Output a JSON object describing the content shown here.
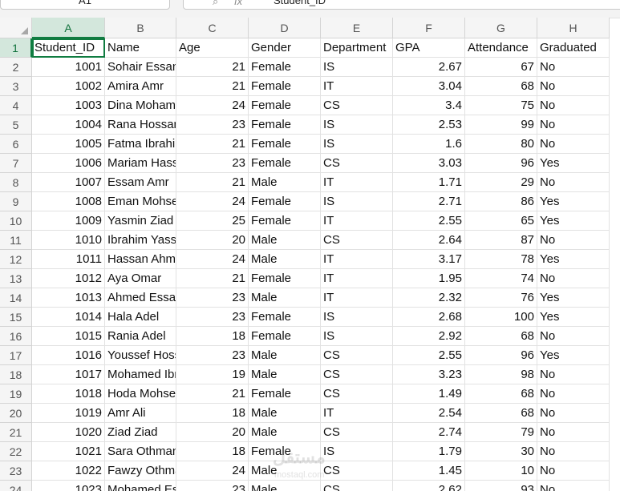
{
  "name_box": "A1",
  "formula_bar": {
    "icons": [
      "search-icon",
      "function-icon"
    ],
    "content": "Student_ID"
  },
  "columns": [
    "A",
    "B",
    "C",
    "D",
    "E",
    "F",
    "G",
    "H"
  ],
  "header_row": [
    "Student_ID",
    "Name",
    "Age",
    "Gender",
    "Department",
    "GPA",
    "Attendance",
    "Graduated"
  ],
  "rows": [
    {
      "n": "2",
      "cells": [
        "1001",
        "Sohair Essam",
        "21",
        "Female",
        "IS",
        "2.67",
        "67",
        "No"
      ]
    },
    {
      "n": "3",
      "cells": [
        "1002",
        "Amira Amr",
        "21",
        "Female",
        "IT",
        "3.04",
        "68",
        "No"
      ]
    },
    {
      "n": "4",
      "cells": [
        "1003",
        "Dina Mohamed",
        "24",
        "Female",
        "CS",
        "3.4",
        "75",
        "No"
      ]
    },
    {
      "n": "5",
      "cells": [
        "1004",
        "Rana Hossam",
        "23",
        "Female",
        "IS",
        "2.53",
        "99",
        "No"
      ]
    },
    {
      "n": "6",
      "cells": [
        "1005",
        "Fatma Ibrahim",
        "21",
        "Female",
        "IS",
        "1.6",
        "80",
        "No"
      ]
    },
    {
      "n": "7",
      "cells": [
        "1006",
        "Mariam Hassan",
        "23",
        "Female",
        "CS",
        "3.03",
        "96",
        "Yes"
      ]
    },
    {
      "n": "8",
      "cells": [
        "1007",
        "Essam Amr",
        "21",
        "Male",
        "IT",
        "1.71",
        "29",
        "No"
      ]
    },
    {
      "n": "9",
      "cells": [
        "1008",
        "Eman Mohsen",
        "24",
        "Female",
        "IS",
        "2.71",
        "86",
        "Yes"
      ]
    },
    {
      "n": "10",
      "cells": [
        "1009",
        "Yasmin Ziad",
        "25",
        "Female",
        "IT",
        "2.55",
        "65",
        "Yes"
      ]
    },
    {
      "n": "11",
      "cells": [
        "1010",
        "Ibrahim Yasser",
        "20",
        "Male",
        "CS",
        "2.64",
        "87",
        "No"
      ]
    },
    {
      "n": "12",
      "cells": [
        "1011",
        "Hassan Ahmed",
        "24",
        "Male",
        "IT",
        "3.17",
        "78",
        "Yes"
      ]
    },
    {
      "n": "13",
      "cells": [
        "1012",
        "Aya Omar",
        "21",
        "Female",
        "IT",
        "1.95",
        "74",
        "No"
      ]
    },
    {
      "n": "14",
      "cells": [
        "1013",
        "Ahmed Essam",
        "23",
        "Male",
        "IT",
        "2.32",
        "76",
        "Yes"
      ]
    },
    {
      "n": "15",
      "cells": [
        "1014",
        "Hala Adel",
        "23",
        "Female",
        "IS",
        "2.68",
        "100",
        "Yes"
      ]
    },
    {
      "n": "16",
      "cells": [
        "1015",
        "Rania Adel",
        "18",
        "Female",
        "IS",
        "2.92",
        "68",
        "No"
      ]
    },
    {
      "n": "17",
      "cells": [
        "1016",
        "Youssef Hossam",
        "23",
        "Male",
        "CS",
        "2.55",
        "96",
        "Yes"
      ]
    },
    {
      "n": "18",
      "cells": [
        "1017",
        "Mohamed Ibrahim",
        "19",
        "Male",
        "CS",
        "3.23",
        "98",
        "No"
      ]
    },
    {
      "n": "19",
      "cells": [
        "1018",
        "Hoda Mohsen",
        "21",
        "Female",
        "CS",
        "1.49",
        "68",
        "No"
      ]
    },
    {
      "n": "20",
      "cells": [
        "1019",
        "Amr Ali",
        "18",
        "Male",
        "IT",
        "2.54",
        "68",
        "No"
      ]
    },
    {
      "n": "21",
      "cells": [
        "1020",
        "Ziad Ziad",
        "20",
        "Male",
        "CS",
        "2.74",
        "79",
        "No"
      ]
    },
    {
      "n": "22",
      "cells": [
        "1021",
        "Sara Othman",
        "18",
        "Female",
        "IS",
        "1.79",
        "30",
        "No"
      ]
    },
    {
      "n": "23",
      "cells": [
        "1022",
        "Fawzy Othman",
        "24",
        "Male",
        "CS",
        "1.45",
        "10",
        "No"
      ]
    },
    {
      "n": "24",
      "cells": [
        "1023",
        "Mohamed Essam",
        "23",
        "Male",
        "CS",
        "2.62",
        "93",
        "No"
      ]
    }
  ],
  "watermark": {
    "text": "مستقل",
    "sub": "mostaql.com"
  },
  "colors": {
    "accent": "#107c41",
    "header_bg": "#f5f5f5",
    "active_header_bg": "#d3e7dc"
  }
}
